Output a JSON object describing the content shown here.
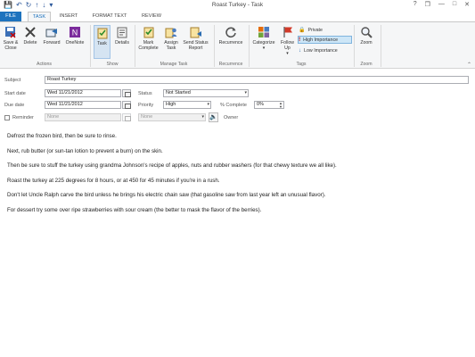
{
  "window": {
    "title": "Roast Turkey - Task",
    "quick_access": [
      "save-icon",
      "undo-icon",
      "redo-icon",
      "up-arrow-icon",
      "down-arrow-icon",
      "customize-icon"
    ],
    "controls": [
      "?",
      "❐",
      "—",
      "□",
      "✕"
    ]
  },
  "tabs": [
    {
      "label": "FILE"
    },
    {
      "label": "TASK"
    },
    {
      "label": "INSERT"
    },
    {
      "label": "FORMAT TEXT"
    },
    {
      "label": "REVIEW"
    }
  ],
  "ribbon": {
    "actions": {
      "save_close": "Save & Close",
      "delete": "Delete",
      "forward": "Forward",
      "onenote": "OneNote",
      "label": "Actions"
    },
    "show": {
      "task": "Task",
      "details": "Details",
      "label": "Show"
    },
    "manage": {
      "mark_complete": "Mark Complete",
      "assign_task": "Assign Task",
      "send_status": "Send Status Report",
      "label": "Manage Task"
    },
    "recurrence": {
      "recurrence": "Recurrence",
      "label": "Recurrence"
    },
    "tags": {
      "categorize": "Categorize",
      "follow_up": "Follow Up",
      "private": "Private",
      "high": "High Importance",
      "low": "Low Importance",
      "label": "Tags"
    },
    "zoom": {
      "zoom": "Zoom",
      "label": "Zoom"
    }
  },
  "form": {
    "subject_label": "Subject",
    "subject_value": "Roast Turkey",
    "start_label": "Start date",
    "start_value": "Wed 11/21/2012",
    "due_label": "Due date",
    "due_value": "Wed 11/21/2012",
    "reminder_label": "Reminder",
    "reminder_date": "None",
    "reminder_time": "None",
    "status_label": "Status",
    "status_value": "Not Started",
    "priority_label": "Priority",
    "priority_value": "High",
    "complete_label": "% Complete",
    "complete_value": "0%",
    "owner_label": "Owner"
  },
  "notes": [
    "Defrost the frozen bird, then be sure to rinse.",
    "Next, rub butter (or sun-tan lotion to prevent a burn) on the skin.",
    "Then be sure to stuff the turkey using grandma Johnson's recipe of apples, nuts and rubber washers (for that chewy texture we all like).",
    "Roast the turkey at 225 degrees for 8 hours, or at 450 for 45 minutes if you're in a rush.",
    "Don't let Uncle Ralph carve the bird unless he brings his electric chain saw (that gasoline saw from last year left an unusual flavor).",
    "For dessert try some over ripe strawberries with sour cream (the better to mask the flavor of the berries)."
  ],
  "colors": {
    "accent": "#1e73be",
    "high_importance": "#c00000",
    "low_importance": "#2b6cb0"
  }
}
